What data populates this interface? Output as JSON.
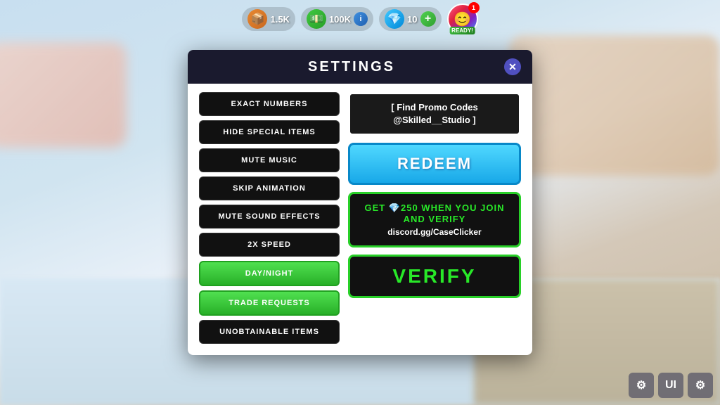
{
  "hud": {
    "box_value": "1.5K",
    "cash_value": "100K",
    "cash_icon": "💵",
    "gem_value": "10",
    "info_label": "i",
    "plus_label": "+",
    "ready_label": "READY!",
    "notification_count": "1"
  },
  "modal": {
    "title": "SETTINGS",
    "close_label": "✕",
    "buttons": [
      {
        "label": "EXACT NUMBERS",
        "active": false
      },
      {
        "label": "HIDE SPECIAL ITEMS",
        "active": false
      },
      {
        "label": "MUTE MUSIC",
        "active": false
      },
      {
        "label": "SKIP ANIMATION",
        "active": false
      },
      {
        "label": "MUTE SOUND EFFECTS",
        "active": false
      },
      {
        "label": "2X SPEED",
        "active": false
      },
      {
        "label": "DAY/NIGHT",
        "active": true
      },
      {
        "label": "TRADE REQUESTS",
        "active": true
      },
      {
        "label": "UNOBTAINABLE ITEMS",
        "active": false
      }
    ],
    "promo": {
      "line1": "[ Find Promo Codes",
      "line2": "@Skilled__Studio ]"
    },
    "redeem_label": "REDEEM",
    "discord": {
      "title": "GET 💎250 WHEN YOU JOIN AND VERIFY",
      "link": "discord.gg/CaseClicker"
    },
    "verify_label": "VERIFY"
  },
  "bottom_ui": {
    "icon1": "⚙",
    "icon2": "UI",
    "icon3": "⚙"
  }
}
